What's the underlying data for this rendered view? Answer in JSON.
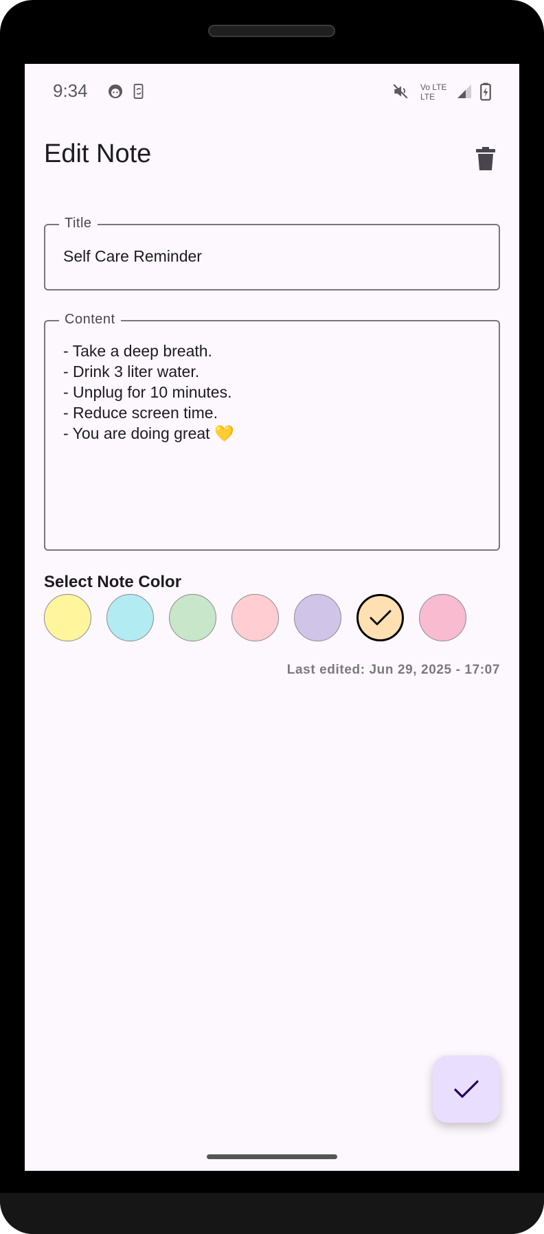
{
  "status_bar": {
    "time": "9:34",
    "network_top": "Vo LTE",
    "network_bottom": "LTE",
    "icons": [
      "face-icon",
      "phone-sync-icon",
      "mute-icon",
      "signal-icon",
      "battery-charging-icon"
    ]
  },
  "app_bar": {
    "title": "Edit Note",
    "delete_icon": "trash-icon"
  },
  "title_field": {
    "label": "Title",
    "value": "Self Care Reminder"
  },
  "content_field": {
    "label": "Content",
    "lines": [
      "- Take a deep breath.",
      "- Drink 3 liter water.",
      "- Unplug for 10 minutes.",
      "- Reduce screen time.",
      "- You are doing great 💛"
    ]
  },
  "color_picker": {
    "title": "Select Note Color",
    "colors": [
      "#fff59d",
      "#b2ebf2",
      "#c8e6c9",
      "#ffcdd2",
      "#d1c4e9",
      "#ffe0b2",
      "#f8bbd0"
    ],
    "selected_index": 5
  },
  "last_edited": "Last edited: Jun 29, 2025 - 17:07",
  "fab": {
    "icon": "check-icon"
  },
  "colors": {
    "screen_bg": "#fdf7fe",
    "fab_bg": "#eadeff",
    "outline": "#79747e"
  }
}
